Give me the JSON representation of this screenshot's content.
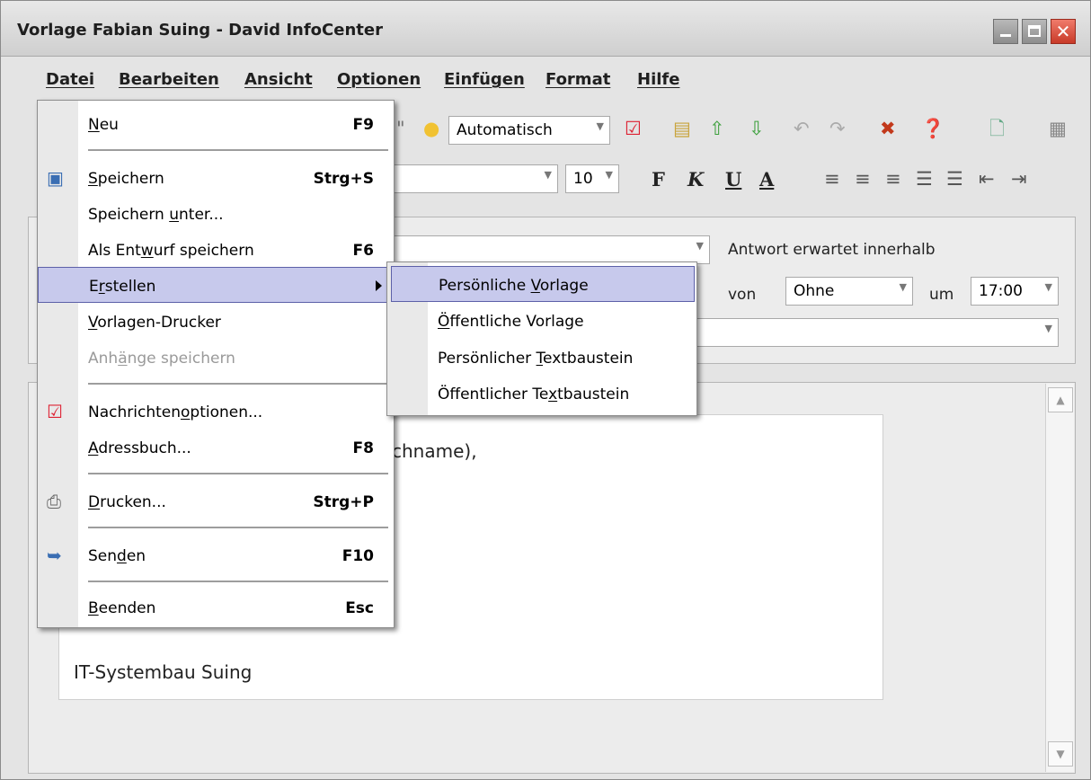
{
  "window": {
    "title": "Vorlage Fabian Suing - David InfoCenter",
    "close_glyph": "✕"
  },
  "menubar": [
    {
      "label": "Datei"
    },
    {
      "label": "Bearbeiten"
    },
    {
      "label": "Ansicht"
    },
    {
      "label": "Optionen"
    },
    {
      "label": "Einfügen"
    },
    {
      "label": "Format"
    },
    {
      "label": "Hilfe"
    }
  ],
  "toolbar": {
    "priority_combo": "Automatisch",
    "quote_glyph": "\"",
    "font_name_partial": "a",
    "font_size": "10",
    "icons": [
      "lightbulb-icon",
      "check-doc-icon",
      "note-icon",
      "arrow-up-green-icon",
      "arrow-down-green-icon",
      "undo-icon",
      "redo-icon",
      "delete-x-icon",
      "help-icon",
      "new-doc-icon",
      "table-icon"
    ],
    "format_buttons": {
      "bold": "F",
      "italic": "K",
      "underline": "U",
      "color": "A"
    }
  },
  "header_panel": {
    "reply_expected_label": "Antwort erwartet innerhalb",
    "von_label": "von",
    "von_value": "Ohne",
    "um_label": "um",
    "time_value": "17:00"
  },
  "editor": {
    "line1_partial": "chname),",
    "signature": "IT-Systembau Suing"
  },
  "file_menu": {
    "items": [
      {
        "label_pre": "",
        "label_u": "N",
        "label_post": "eu",
        "shortcut": "F9",
        "icon": "",
        "disabled": false
      },
      {
        "label_pre": "",
        "label_u": "S",
        "label_post": "peichern",
        "shortcut": "Strg+S",
        "icon": "save-icon",
        "disabled": false
      },
      {
        "label_pre": "Speichern ",
        "label_u": "u",
        "label_post": "nter...",
        "shortcut": "",
        "icon": "",
        "disabled": false
      },
      {
        "label_pre": "Als Ent",
        "label_u": "w",
        "label_post": "urf speichern",
        "shortcut": "F6",
        "icon": "",
        "disabled": false
      },
      {
        "label_pre": "E",
        "label_u": "r",
        "label_post": "stellen",
        "shortcut": "",
        "icon": "",
        "disabled": false
      },
      {
        "label_pre": "",
        "label_u": "V",
        "label_post": "orlagen-Drucker",
        "shortcut": "",
        "icon": "",
        "disabled": false
      },
      {
        "label_pre": "Anh",
        "label_u": "ä",
        "label_post": "nge speichern",
        "shortcut": "",
        "icon": "",
        "disabled": true
      },
      {
        "label_pre": "Nachrichten",
        "label_u": "o",
        "label_post": "ptionen...",
        "shortcut": "",
        "icon": "check-doc-icon",
        "disabled": false
      },
      {
        "label_pre": "",
        "label_u": "A",
        "label_post": "dressbuch...",
        "shortcut": "F8",
        "icon": "",
        "disabled": false
      },
      {
        "label_pre": "",
        "label_u": "D",
        "label_post": "rucken...",
        "shortcut": "Strg+P",
        "icon": "printer-icon",
        "disabled": false
      },
      {
        "label_pre": "Sen",
        "label_u": "d",
        "label_post": "en",
        "shortcut": "F10",
        "icon": "send-icon",
        "disabled": false
      },
      {
        "label_pre": "",
        "label_u": "B",
        "label_post": "eenden",
        "shortcut": "Esc",
        "icon": "",
        "disabled": false
      }
    ]
  },
  "submenu_erstellen": {
    "items": [
      {
        "label_pre": "Persönliche ",
        "label_u": "V",
        "label_post": "orlage"
      },
      {
        "label_pre": "",
        "label_u": "Ö",
        "label_post": "ffentliche Vorlage"
      },
      {
        "label_pre": "Persönlicher ",
        "label_u": "T",
        "label_post": "extbaustein"
      },
      {
        "label_pre": "Öffentlicher Te",
        "label_u": "x",
        "label_post": "tbaustein"
      }
    ]
  },
  "colors": {
    "highlight": "#c7c9ec",
    "highlight_border": "#5c60a8",
    "close_button": "#d9442f"
  }
}
